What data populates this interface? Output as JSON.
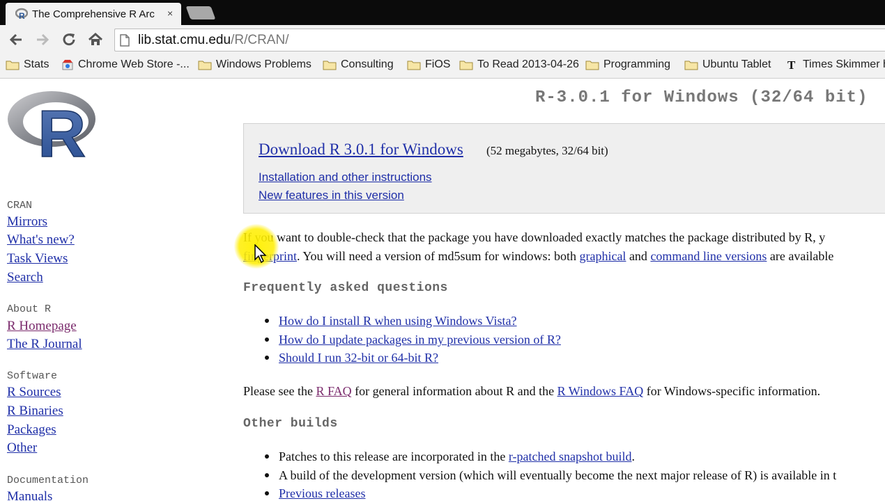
{
  "browser": {
    "tab_title": "The Comprehensive R Arc",
    "tab_close": "×",
    "url_host": "lib.stat.cmu.edu",
    "url_path": "/R/CRAN/"
  },
  "bookmarks": [
    {
      "label": "Stats",
      "icon": "folder-icon"
    },
    {
      "label": "Chrome Web Store -...",
      "icon": "chrome-store-icon"
    },
    {
      "label": "Windows Problems",
      "icon": "folder-icon"
    },
    {
      "label": "Consulting",
      "icon": "folder-icon"
    },
    {
      "label": "FiOS",
      "icon": "folder-icon"
    },
    {
      "label": "To Read 2013-04-26",
      "icon": "folder-icon"
    },
    {
      "label": "Programming",
      "icon": "folder-icon"
    },
    {
      "label": "Ubuntu Tablet",
      "icon": "folder-icon"
    },
    {
      "label": "Times Skimmer h",
      "icon": "nyt-icon"
    }
  ],
  "sidebar": {
    "cran_head": "CRAN",
    "mirrors": "Mirrors",
    "whats_new": "What's new?",
    "task_views": "Task Views",
    "search": "Search",
    "about_head": "About R",
    "r_homepage": "R Homepage",
    "r_journal": "The R Journal",
    "software_head": "Software",
    "r_sources": "R Sources",
    "r_binaries": "R Binaries",
    "packages": "Packages",
    "other": "Other",
    "documentation_head": "Documentation",
    "manuals": "Manuals"
  },
  "main": {
    "heading": "R-3.0.1 for Windows (32/64 bit)",
    "download_link": "Download R 3.0.1 for Windows",
    "download_size": "(52 megabytes, 32/64 bit)",
    "install_link": "Installation and other instructions",
    "features_link": "New features in this version",
    "check_p1": "If you want to double-check that the package you have downloaded exactly matches the package distributed by R, y",
    "fingerprint_link": "fingerprint",
    "check_p2a": ". You will need a version of md5sum for windows: both ",
    "graphical_link": "graphical",
    "check_p2b": " and ",
    "cmdline_link": "command line versions",
    "check_p2c": " are available",
    "faq_head": "Frequently asked questions",
    "faq_items": [
      "How do I install R when using Windows Vista?",
      "How do I update packages in my previous version of R?",
      "Should I run 32-bit or 64-bit R?"
    ],
    "see_p1": "Please see the ",
    "rfaq_link": "R FAQ",
    "see_p2": " for general information about R and the ",
    "rwinfaq_link": "R Windows FAQ",
    "see_p3": " for Windows-specific information.",
    "other_head": "Other builds",
    "patches_text": "Patches to this release are incorporated in the ",
    "patched_link": "r-patched snapshot build",
    "patches_end": ".",
    "devel_text": "A build of the development version (which will eventually become the next major release of R) is available in t",
    "previous_link": "Previous releases"
  }
}
